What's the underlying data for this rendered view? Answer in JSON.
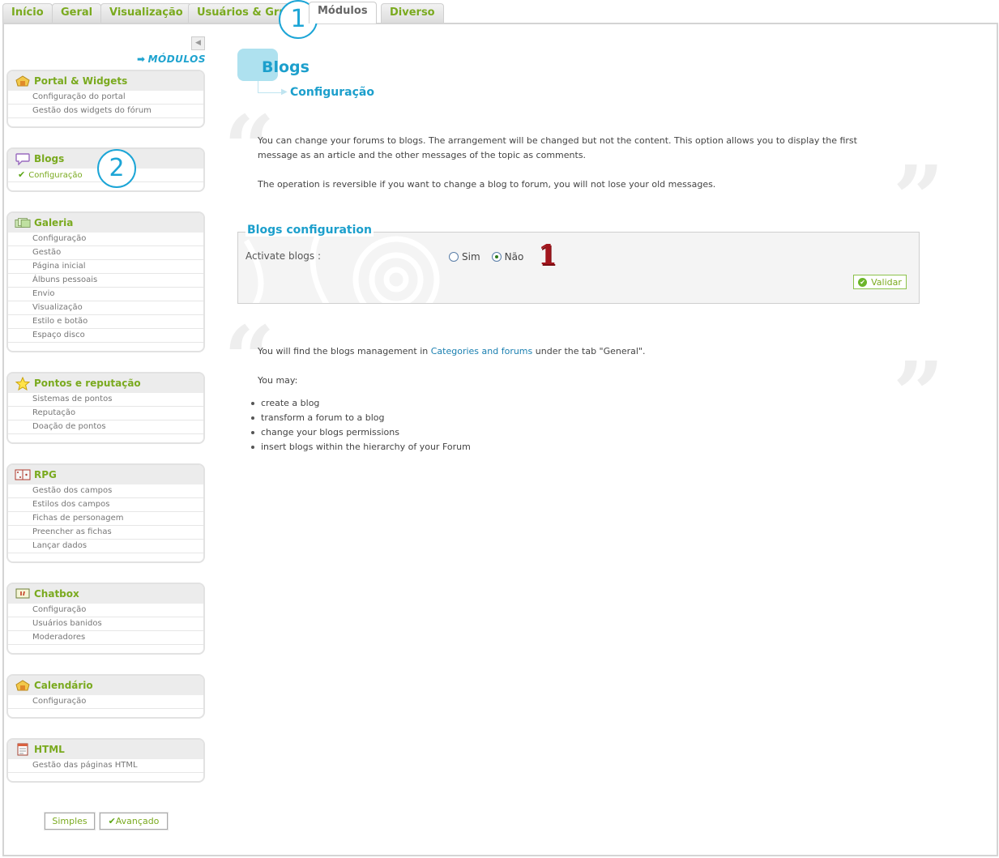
{
  "tabs": [
    {
      "label": "Início",
      "active": false
    },
    {
      "label": "Geral",
      "active": false
    },
    {
      "label": "Visualização",
      "active": false
    },
    {
      "label": "Usuários & Grupos",
      "active": false
    },
    {
      "label": "Módulos",
      "active": true
    },
    {
      "label": "Diverso",
      "active": false
    }
  ],
  "sidebar": {
    "title": "MÓDULOS",
    "sections": [
      {
        "title": "Portal & Widgets",
        "icon": "portal-icon",
        "items": [
          "Configuração do portal",
          "Gestão dos widgets do fórum"
        ]
      },
      {
        "title": "Blogs",
        "icon": "speech-bubble-icon",
        "items": [
          "Configuração"
        ],
        "active_item": 0
      },
      {
        "title": "Galeria",
        "icon": "gallery-icon",
        "items": [
          "Configuração",
          "Gestão",
          "Página inicial",
          "Álbuns pessoais",
          "Envio",
          "Visualização",
          "Estilo e botão",
          "Espaço disco"
        ]
      },
      {
        "title": "Pontos e reputação",
        "icon": "star-icon",
        "items": [
          "Sistemas de pontos",
          "Reputação",
          "Doação de pontos"
        ]
      },
      {
        "title": "RPG",
        "icon": "dice-icon",
        "items": [
          "Gestão dos campos",
          "Estilos dos campos",
          "Fichas de personagem",
          "Preencher as fichas",
          "Lançar dados"
        ]
      },
      {
        "title": "Chatbox",
        "icon": "chat-icon",
        "items": [
          "Configuração",
          "Usuários banidos",
          "Moderadores"
        ]
      },
      {
        "title": "Calendário",
        "icon": "calendar-icon",
        "items": [
          "Configuração"
        ]
      },
      {
        "title": "HTML",
        "icon": "html-page-icon",
        "items": [
          "Gestão das páginas HTML"
        ]
      }
    ],
    "mode_simple": "Simples",
    "mode_advanced": "Avançado"
  },
  "content": {
    "title": "Blogs",
    "subtitle": "Configuração",
    "intro_1a": "You can change your forums to blogs. The arrangement will be changed but not the content. This option allows you to display the first",
    "intro_1b": "message as an article and the other messages of the topic as comments.",
    "intro_2": "The operation is reversible if you want to change a blog to forum, you will not lose your old messages.",
    "form": {
      "legend": "Blogs configuration",
      "field_label": "Activate blogs :",
      "option_yes": "Sim",
      "option_no": "Não",
      "selected": "Não",
      "submit": "Validar"
    },
    "info_prefix": "You will find the blogs management in ",
    "info_link": "Categories and forums",
    "info_suffix": " under the tab \"General\".",
    "you_may": "You may:",
    "bullets": [
      "create a blog",
      "transform a forum to a blog",
      "change your blogs permissions",
      "insert blogs within the hierarchy of your Forum"
    ]
  },
  "annotations": {
    "circle_1": "1",
    "circle_2": "2",
    "red_1": "1"
  },
  "colors": {
    "accent_green": "#7aaa1f",
    "accent_blue": "#1c9fcc",
    "annotation_red": "#a2161d"
  }
}
